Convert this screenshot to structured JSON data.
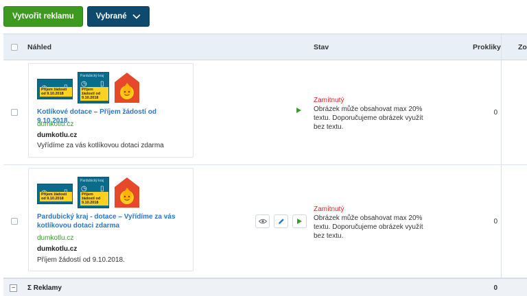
{
  "toolbar": {
    "create_label": "Vytvořit reklamu",
    "selected_label": "Vybrané"
  },
  "columns": {
    "preview": "Náhled",
    "status": "Stav",
    "clicks": "Prokliky",
    "next": "Zo"
  },
  "ads": [
    {
      "thumb_small_label": "Příjem žádostí od 9.10.2018",
      "thumb_big_header": "Pardubický kraj",
      "thumb_big_label": "Příjem žádostí od 9.10.2018",
      "title": "Kotlíkové dotace – Příjem žádostí od 9.10.2018.",
      "domain": "dumkotlu.cz",
      "site": "dumkotlu.cz",
      "description": "Vyřídíme za vás kotlíkovou dotaci zdarma",
      "status_title": "Zamítnutý",
      "status_text": "Obrázek může obsahovat max 20% textu. Doporučujeme obrázek využít bez textu.",
      "clicks": "0"
    },
    {
      "thumb_small_label": "Příjem žádostí od 9.10.2018",
      "thumb_big_header": "Pardubický kraj",
      "thumb_big_label": "Příjem žádostí od 9.10.2018",
      "title": "Pardubický kraj - dotace – Vyřídíme za vás kotlíkovou dotaci zdarma",
      "domain": "dumkotlu.cz",
      "site": "dumkotlu.cz",
      "description": "Příjem žádostí od 9.10.2018.",
      "status_title": "Zamítnutý",
      "status_text": "Obrázek může obsahovat max 20% textu. Doporučujeme obrázek využít bez textu.",
      "clicks": "0"
    }
  ],
  "footer": {
    "label": "Σ Reklamy",
    "clicks_total": "0"
  },
  "icons": {
    "dropdown": "chevron-down-icon",
    "play": "play-icon",
    "preview": "eye-icon",
    "edit": "pencil-icon",
    "collapse": "minus-icon"
  },
  "colors": {
    "create_button": "#3c9a1e",
    "selected_button": "#0e4a6e",
    "rejected": "#d22222",
    "ad_title": "#2a77c9",
    "ad_domain": "#3a9a2e",
    "header_bg": "#e9eff7"
  }
}
